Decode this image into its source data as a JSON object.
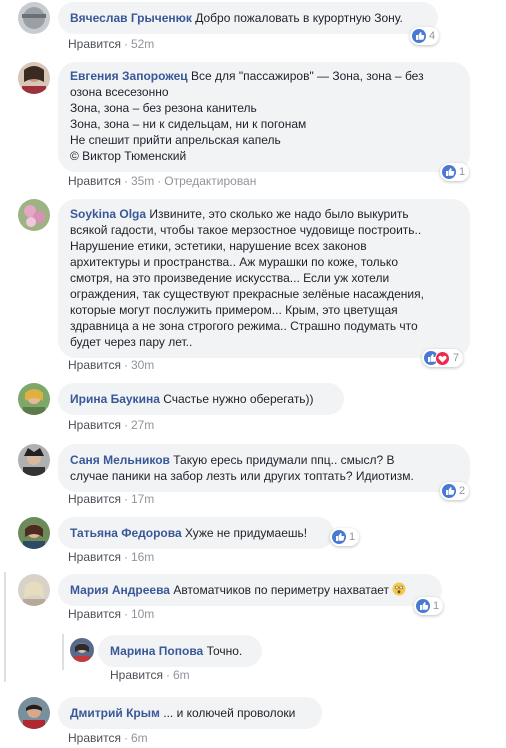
{
  "colors": {
    "author": "#385898",
    "bubble": "#f2f3f5",
    "meta": "#90949c",
    "like_reaction": "#4a79d3",
    "love_reaction": "#f0284a"
  },
  "comments": [
    {
      "author": "Вячеслав Грыченюк",
      "lines": [
        "Добро пожаловать в курортную Зону."
      ],
      "like": "Нравится",
      "time": "52m",
      "reactions": "4"
    },
    {
      "author": "Евгения Запорожец",
      "lines": [
        "Все для \"пассажиров\" — Зона, зона – без",
        "озона всесезонно",
        "Зона, зона – без резона канитель",
        "Зона, зона – ни к сидельцам, ни к погонам",
        "Не спешит прийти апрельская капель",
        "© Виктор Тюменский"
      ],
      "like": "Нравится",
      "time": "35m",
      "edited": "Отредактирован",
      "reactions": "1"
    },
    {
      "author": "Soykina Olga",
      "lines": [
        "Извините, это сколько же надо было выкурить",
        "всякой гадости, чтобы такое мерзостное чудовище построить..",
        "Нарушение етики, эстетики, нарушение всех законов",
        "архитектуры и пространства.. Аж мурашки по коже, только",
        "смотря, на это произведение искусства... Если уж хотели",
        "ограждения, так существуют прекрасные зелёные насаждения,",
        "которые могут послужить примером... Крым, это цветущая",
        "здравница а не зона строгого режима.. Страшно подумать что",
        "будет через пару лет.."
      ],
      "like": "Нравится",
      "time": "30m",
      "reactions": "7"
    },
    {
      "author": "Ирина Баукина",
      "lines": [
        "Счастье нужно оберегать))"
      ],
      "like": "Нравится",
      "time": "27m"
    },
    {
      "author": "Саня Мельников",
      "lines": [
        "Такую ересь придумали ппц.. смысл? В",
        "случае паники на забор лезть или других топтать? Идиотизм."
      ],
      "like": "Нравится",
      "time": "17m",
      "reactions": "2"
    },
    {
      "author": "Татьяна Федорова",
      "lines": [
        "Хуже не придумаешь!"
      ],
      "like": "Нравится",
      "time": "16m",
      "reactions": "1"
    },
    {
      "author": "Мария Андреева",
      "lines": [
        "Автоматчиков по периметру нахватает"
      ],
      "like": "Нравится",
      "time": "10m",
      "reactions": "1"
    },
    {
      "author": "Марина Попова",
      "lines": [
        "Точно."
      ],
      "like": "Нравится",
      "time": "6m"
    },
    {
      "author": "Дмитрий Крым",
      "lines": [
        "... и колючей проволоки"
      ],
      "like": "Нравится",
      "time": "6m"
    }
  ]
}
